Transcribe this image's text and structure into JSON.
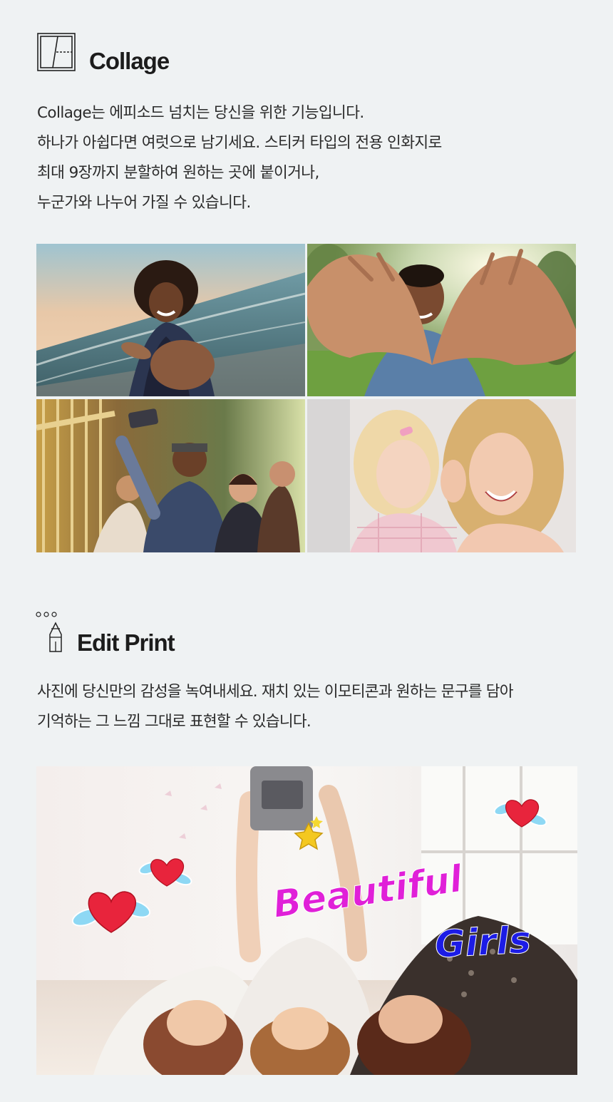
{
  "collage": {
    "icon": "collage-layout-icon",
    "title": "Collage",
    "description_lines": [
      " Collage는 에피소드 넘치는 당신을 위한 기능입니다.",
      "하나가 아쉽다면 여럿으로 남기세요. 스티커 타입의 전용 인화지로",
      "최대 9장까지 분할하여 원하는 곳에 붙이거나,",
      "누군가와 나누어 가질 수 있습니다."
    ],
    "photos": [
      "beach-woman-photo",
      "man-heart-hands-photo",
      "group-selfie-photo",
      "mother-daughter-photo"
    ]
  },
  "edit_print": {
    "icon": "pen-tool-icon",
    "title": "Edit Print",
    "description_lines": [
      "사진에 당신만의 감성을 녹여내세요. 재치 있는 이모티콘과 원하는 문구를 담아",
      "기억하는 그 느낌 그대로 표현할 수 있습니다."
    ],
    "photo": "girls-selfie-photo",
    "sticker_text_1": "Beautiful",
    "sticker_text_2": "Girls",
    "colors": {
      "sticker_pink": "#e020d8",
      "sticker_blue": "#1c1ce6",
      "heart_red": "#e8243c",
      "wing_blue": "#7fd0f0"
    }
  },
  "colors": {
    "background": "#eff2f3",
    "text": "#1c1c1c"
  }
}
